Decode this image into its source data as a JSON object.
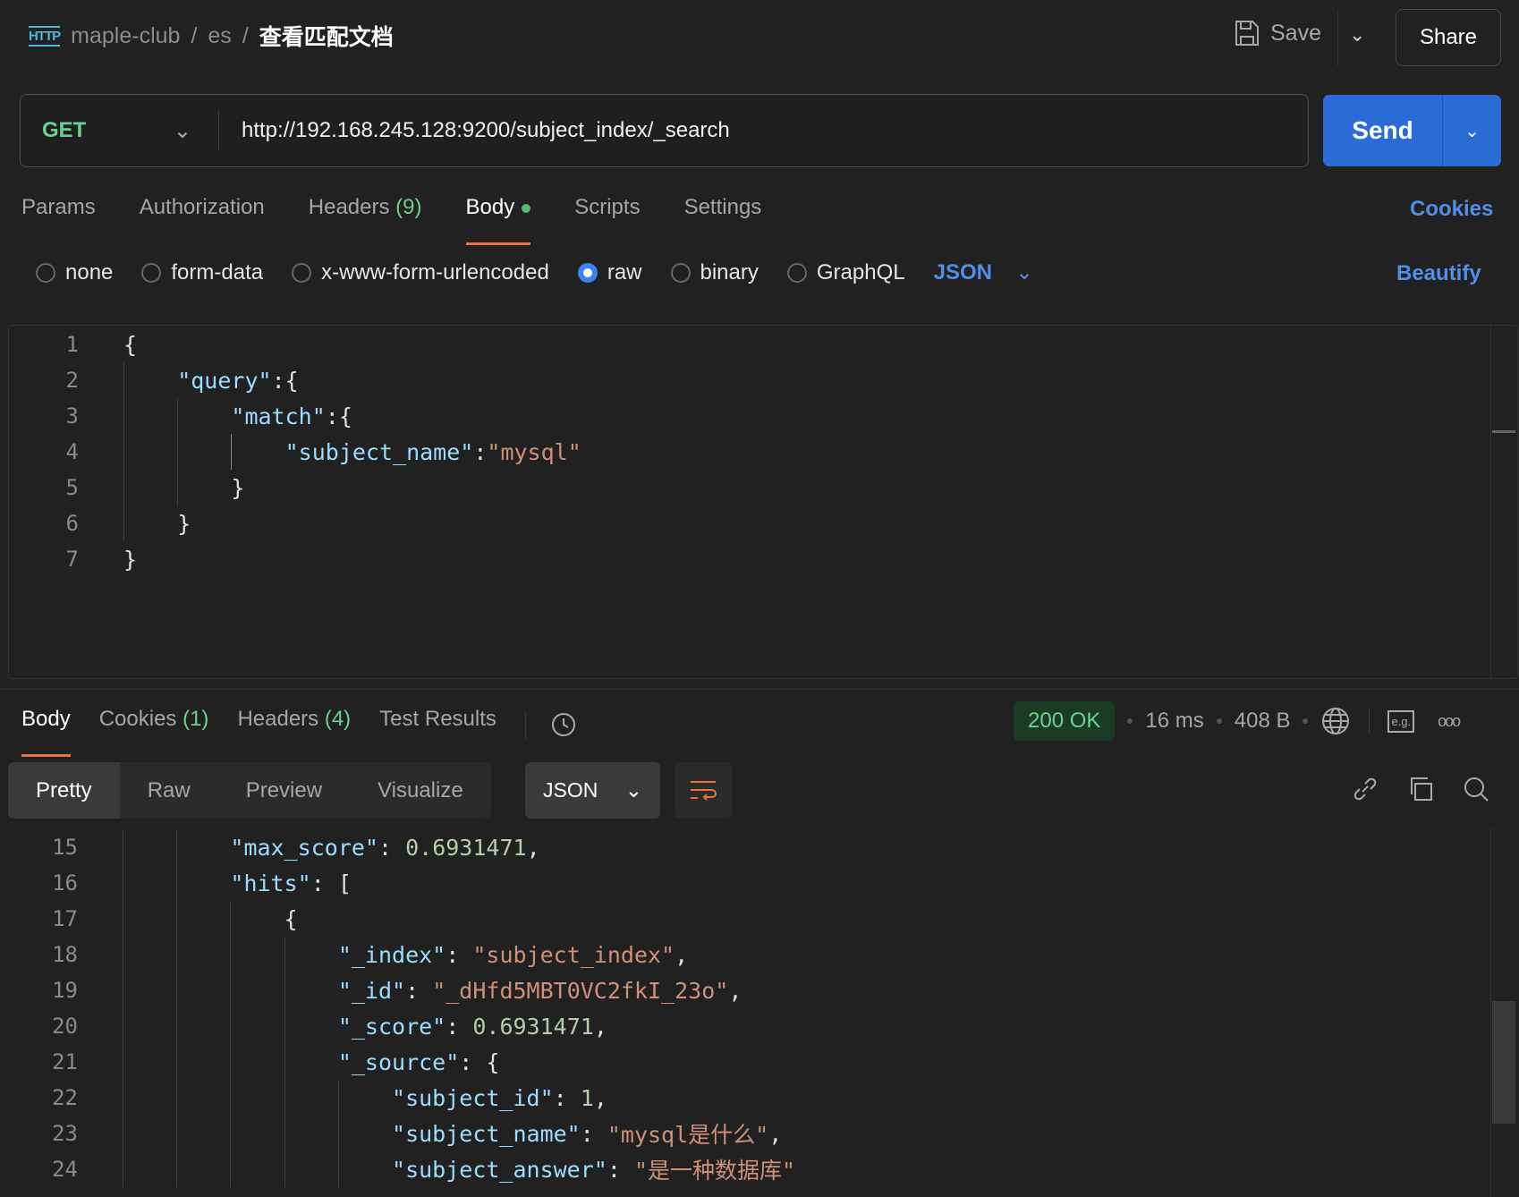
{
  "header": {
    "icon": "http-icon",
    "breadcrumb": [
      "maple-club",
      "es"
    ],
    "title": "查看匹配文档",
    "save_label": "Save",
    "share_label": "Share"
  },
  "request": {
    "method": "GET",
    "url": "http://192.168.245.128:9200/subject_index/_search",
    "send_label": "Send"
  },
  "tabs": [
    {
      "label": "Params"
    },
    {
      "label": "Authorization"
    },
    {
      "label": "Headers",
      "count": "(9)"
    },
    {
      "label": "Body",
      "active": true
    },
    {
      "label": "Scripts"
    },
    {
      "label": "Settings"
    }
  ],
  "cookies_label": "Cookies",
  "body_types": [
    {
      "label": "none"
    },
    {
      "label": "form-data"
    },
    {
      "label": "x-www-form-urlencoded"
    },
    {
      "label": "raw",
      "selected": true
    },
    {
      "label": "binary"
    },
    {
      "label": "GraphQL"
    }
  ],
  "body_format": "JSON",
  "beautify_label": "Beautify",
  "request_body": [
    {
      "n": "1",
      "i": 0,
      "t": [
        [
          "p",
          "{"
        ]
      ]
    },
    {
      "n": "2",
      "i": 1,
      "t": [
        [
          "k",
          "\"query\""
        ],
        [
          "p",
          ":{"
        ]
      ]
    },
    {
      "n": "3",
      "i": 2,
      "t": [
        [
          "k",
          "\"match\""
        ],
        [
          "p",
          ":{"
        ]
      ]
    },
    {
      "n": "4",
      "i": 3,
      "t": [
        [
          "k",
          "\"subject_name\""
        ],
        [
          "p",
          ":"
        ],
        [
          "s",
          "\"mysql\""
        ]
      ]
    },
    {
      "n": "5",
      "i": 2,
      "t": [
        [
          "p",
          "}"
        ]
      ]
    },
    {
      "n": "6",
      "i": 1,
      "t": [
        [
          "p",
          "}"
        ]
      ]
    },
    {
      "n": "7",
      "i": 0,
      "t": [
        [
          "p",
          "}"
        ]
      ]
    }
  ],
  "response": {
    "tabs": [
      {
        "label": "Body",
        "active": true
      },
      {
        "label": "Cookies",
        "count": "(1)"
      },
      {
        "label": "Headers",
        "count": "(4)"
      },
      {
        "label": "Test Results"
      }
    ],
    "status": "200 OK",
    "time": "16 ms",
    "size": "408 B",
    "views": [
      "Pretty",
      "Raw",
      "Preview",
      "Visualize"
    ],
    "active_view": "Pretty",
    "format": "JSON",
    "lines": [
      {
        "n": "15",
        "i": 2,
        "t": [
          [
            "k",
            "\"max_score\""
          ],
          [
            "p",
            ": "
          ],
          [
            "n",
            "0.6931471"
          ],
          [
            "p",
            ","
          ]
        ]
      },
      {
        "n": "16",
        "i": 2,
        "t": [
          [
            "k",
            "\"hits\""
          ],
          [
            "p",
            ": ["
          ]
        ]
      },
      {
        "n": "17",
        "i": 3,
        "t": [
          [
            "p",
            "{"
          ]
        ]
      },
      {
        "n": "18",
        "i": 4,
        "t": [
          [
            "k",
            "\"_index\""
          ],
          [
            "p",
            ": "
          ],
          [
            "s",
            "\"subject_index\""
          ],
          [
            "p",
            ","
          ]
        ]
      },
      {
        "n": "19",
        "i": 4,
        "t": [
          [
            "k",
            "\"_id\""
          ],
          [
            "p",
            ": "
          ],
          [
            "s",
            "\"_dHfd5MBT0VC2fkI_23o\""
          ],
          [
            "p",
            ","
          ]
        ]
      },
      {
        "n": "20",
        "i": 4,
        "t": [
          [
            "k",
            "\"_score\""
          ],
          [
            "p",
            ": "
          ],
          [
            "n",
            "0.6931471"
          ],
          [
            "p",
            ","
          ]
        ]
      },
      {
        "n": "21",
        "i": 4,
        "t": [
          [
            "k",
            "\"_source\""
          ],
          [
            "p",
            ": {"
          ]
        ]
      },
      {
        "n": "22",
        "i": 5,
        "t": [
          [
            "k",
            "\"subject_id\""
          ],
          [
            "p",
            ": "
          ],
          [
            "n",
            "1"
          ],
          [
            "p",
            ","
          ]
        ]
      },
      {
        "n": "23",
        "i": 5,
        "t": [
          [
            "k",
            "\"subject_name\""
          ],
          [
            "p",
            ": "
          ],
          [
            "s",
            "\"mysql是什么\""
          ],
          [
            "p",
            ","
          ]
        ]
      },
      {
        "n": "24",
        "i": 5,
        "t": [
          [
            "k",
            "\"subject_answer\""
          ],
          [
            "p",
            ": "
          ],
          [
            "s",
            "\"是一种数据库\""
          ]
        ]
      }
    ]
  },
  "colors": {
    "accent": "#e8733f",
    "send": "#2a6bd6",
    "link": "#4f8fe8",
    "ok": "#6bd18e"
  }
}
